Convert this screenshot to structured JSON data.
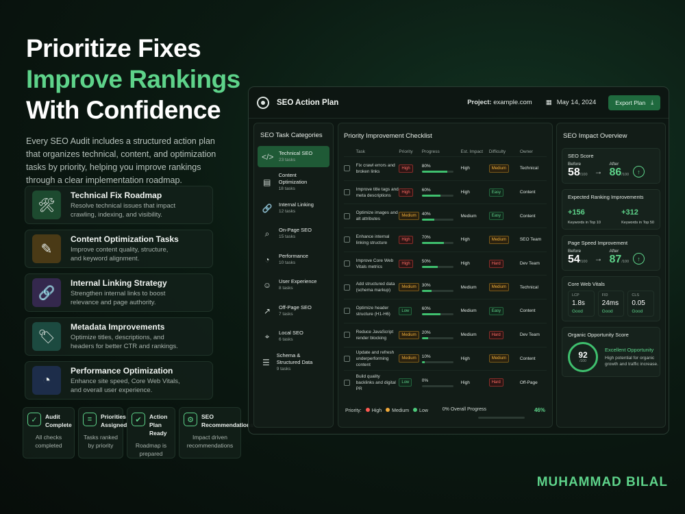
{
  "hero": {
    "line1": "Prioritize Fixes",
    "line2": "Improve Rankings",
    "line3": "With Confidence",
    "description": "Every SEO Audit includes a structured action plan that organizes technical, content, and optimization tasks by priority, helping you improve rankings through a clear implementation roadmap."
  },
  "features": [
    {
      "title": "Technical Fix Roadmap",
      "desc": "Resolve technical issues that impact crawling, indexing, and visibility.",
      "icon": "wrench-icon",
      "glyph": "🛠",
      "bg": "#1d4a2f"
    },
    {
      "title": "Content Optimization Tasks",
      "desc": "Improve content quality, structure, and keyword alignment.",
      "icon": "document-edit-icon",
      "glyph": "✎",
      "bg": "#4a3a16"
    },
    {
      "title": "Internal Linking Strategy",
      "desc": "Strengthen internal links to boost relevance and page authority.",
      "icon": "link-icon",
      "glyph": "🔗",
      "bg": "#34284d"
    },
    {
      "title": "Metadata Improvements",
      "desc": "Optimize titles, descriptions, and headers for better CTR and rankings.",
      "icon": "tag-icon",
      "glyph": "🏷",
      "bg": "#1c4a40"
    },
    {
      "title": "Performance Optimization",
      "desc": "Enhance site speed, Core Web Vitals, and overall user experience.",
      "icon": "speedometer-icon",
      "glyph": "◔",
      "bg": "#1d2d4a"
    }
  ],
  "status_cards": [
    {
      "title": "Audit Complete",
      "desc": "All checks completed",
      "icon": "check-circle-icon",
      "glyph": "✓"
    },
    {
      "title": "Priorities Assigned",
      "desc": "Tasks ranked by priority",
      "icon": "list-icon",
      "glyph": "≡"
    },
    {
      "title": "Action Plan Ready",
      "desc": "Roadmap is prepared",
      "icon": "clipboard-check-icon",
      "glyph": "✔"
    },
    {
      "title": "SEO Recommendations",
      "desc": "Impact driven recommendations",
      "icon": "gear-icon",
      "glyph": "⚙"
    }
  ],
  "app": {
    "title": "SEO Action Plan",
    "project_label": "Project:",
    "project_value": "example.com",
    "date": "May 14, 2024",
    "export_label": "Export Plan"
  },
  "categories": {
    "title": "SEO Task Categories",
    "items": [
      {
        "name": "Technical SEO",
        "count": "23 tasks",
        "icon": "code-icon",
        "glyph": "</>"
      },
      {
        "name": "Content Optimization",
        "count": "18 tasks",
        "icon": "document-icon",
        "glyph": "▤"
      },
      {
        "name": "Internal Linking",
        "count": "12 tasks",
        "icon": "link-icon",
        "glyph": "🔗"
      },
      {
        "name": "On-Page SEO",
        "count": "15 tasks",
        "icon": "search-icon",
        "glyph": "⌕"
      },
      {
        "name": "Performance",
        "count": "10 tasks",
        "icon": "gauge-icon",
        "glyph": "◔"
      },
      {
        "name": "User Experience",
        "count": "8 tasks",
        "icon": "user-icon",
        "glyph": "☺"
      },
      {
        "name": "Off-Page SEO",
        "count": "7 tasks",
        "icon": "external-link-icon",
        "glyph": "↗"
      },
      {
        "name": "Local SEO",
        "count": "6 tasks",
        "icon": "map-pin-icon",
        "glyph": "⌖"
      },
      {
        "name": "Schema & Structured Data",
        "count": "9 tasks",
        "icon": "database-icon",
        "glyph": "☰"
      }
    ]
  },
  "checklist": {
    "title": "Priority Improvement Checklist",
    "headers": [
      "Task",
      "Priority",
      "Progress",
      "Est. Impact",
      "Difficulty",
      "Owner"
    ],
    "rows": [
      {
        "task": "Fix crawl errors and broken links",
        "priority": "High",
        "progress": "80%",
        "pct": 0.8,
        "impact": "High",
        "difficulty": "Medium",
        "owner": "Technical"
      },
      {
        "task": "Improve title tags and meta descriptions",
        "priority": "High",
        "progress": "60%",
        "pct": 0.6,
        "impact": "High",
        "difficulty": "Easy",
        "owner": "Content"
      },
      {
        "task": "Optimize images and alt attributes",
        "priority": "Medium",
        "progress": "40%",
        "pct": 0.4,
        "impact": "Medium",
        "difficulty": "Easy",
        "owner": "Content"
      },
      {
        "task": "Enhance internal linking structure",
        "priority": "High",
        "progress": "70%",
        "pct": 0.7,
        "impact": "High",
        "difficulty": "Medium",
        "owner": "SEO Team"
      },
      {
        "task": "Improve Core Web Vitals metrics",
        "priority": "High",
        "progress": "50%",
        "pct": 0.5,
        "impact": "High",
        "difficulty": "Hard",
        "owner": "Dev Team"
      },
      {
        "task": "Add structured data (schema markup)",
        "priority": "Medium",
        "progress": "30%",
        "pct": 0.3,
        "impact": "Medium",
        "difficulty": "Medium",
        "owner": "Technical"
      },
      {
        "task": "Optimize header structure (H1-H6)",
        "priority": "Low",
        "progress": "60%",
        "pct": 0.6,
        "impact": "Medium",
        "difficulty": "Easy",
        "owner": "Content"
      },
      {
        "task": "Reduce JavaScript render blocking",
        "priority": "Medium",
        "progress": "20%",
        "pct": 0.2,
        "impact": "Medium",
        "difficulty": "Hard",
        "owner": "Dev Team"
      },
      {
        "task": "Update and refresh underperforming content",
        "priority": "Medium",
        "progress": "10%",
        "pct": 0.1,
        "impact": "High",
        "difficulty": "Medium",
        "owner": "Content"
      },
      {
        "task": "Build quality backlinks and digital PR",
        "priority": "Low",
        "progress": "0%",
        "pct": 0.0,
        "impact": "High",
        "difficulty": "Hard",
        "owner": "Off-Page"
      }
    ],
    "legend_label": "Priority:",
    "legend": [
      {
        "label": "High",
        "color": "#ff5a52"
      },
      {
        "label": "Medium",
        "color": "#f2a93a"
      },
      {
        "label": "Low",
        "color": "#4cc97a"
      }
    ],
    "overall_label": "0% Overall Progress",
    "overall_value": "46%"
  },
  "impact": {
    "title": "SEO Impact Overview",
    "seo_score": {
      "title": "SEO Score",
      "before_label": "Before",
      "before": "58",
      "after_label": "After",
      "after": "86",
      "suffix": "/100"
    },
    "ranking": {
      "title": "Expected Ranking Improvements",
      "top10_value": "+156",
      "top10_label": "Keywords in Top 10",
      "top50_value": "+312",
      "top50_label": "Keywords in Top 50"
    },
    "speed": {
      "title": "Page Speed Improvement",
      "before_label": "Before",
      "before": "54",
      "after_label": "After",
      "after": "87",
      "suffix": "/100"
    },
    "cwv": {
      "title": "Core Web Vitals",
      "metrics": [
        {
          "name": "LCP",
          "value": "1.8s",
          "status": "Good"
        },
        {
          "name": "FID",
          "value": "24ms",
          "status": "Good"
        },
        {
          "name": "CLS",
          "value": "0.05",
          "status": "Good"
        }
      ]
    },
    "opportunity": {
      "title": "Organic Opportunity Score",
      "value": "92",
      "suffix": "/100",
      "label": "Excellent Opportunity",
      "desc": "High potential for organic growth and traffic increase."
    }
  },
  "author": "MUHAMMAD BILAL",
  "colors": {
    "accent": "#5ed38a",
    "active": "#1f5a36"
  }
}
